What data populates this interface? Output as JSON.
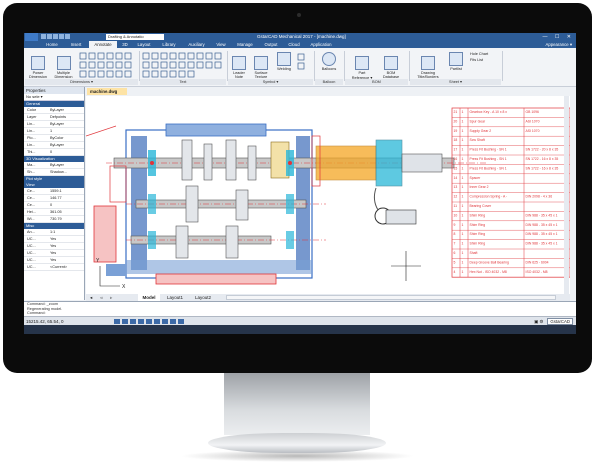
{
  "app": {
    "title": "GstarCAD Mechanical 2017 - [machine.dwg]",
    "workspace": "Drafting & Annotatio",
    "window_controls": "— ☐ ✕"
  },
  "tabs": [
    "Home",
    "Insert",
    "Annotate",
    "3D",
    "Layout",
    "Library",
    "Auxiliary",
    "View",
    "Manage",
    "Output",
    "Cloud",
    "Application"
  ],
  "active_tab": "Annotate",
  "ribbon_right": "Appearance ▾",
  "ribbon": {
    "power_dimension": "Power\nDimension",
    "multiple_dimension": "Multiple\nDimension",
    "leader_note": "Leader\nNote",
    "surface_texture": "Surface\nTexture",
    "welding": "Welding",
    "balloons": "Balloons",
    "part_reference": "Part\nReference ▾",
    "bom_database": "BOM\nDatabase",
    "drawing_title": "Drawing\nTitle/Borders",
    "partlist": "Partlist",
    "hole_chart": "Hole Chart",
    "fits_list": "Fits List",
    "groups": [
      "Dimensions ▾",
      "Text",
      "Symbol ▾",
      "Balloon",
      "BOM",
      "Sheet ▾"
    ]
  },
  "properties": {
    "header": "Properties",
    "selection": "No sele ▾",
    "sections": {
      "general": "General",
      "visualization": "3D Visualization",
      "plot": "Plot style",
      "view": "View",
      "misc": "Misc"
    },
    "general_rows": [
      {
        "k": "Color",
        "v": "ByLayer"
      },
      {
        "k": "Layer",
        "v": "Defpoints"
      },
      {
        "k": "Lin...",
        "v": "ByLayer"
      },
      {
        "k": "Lin...",
        "v": "1"
      },
      {
        "k": "Plo...",
        "v": "ByColor"
      },
      {
        "k": "Lin...",
        "v": "ByLayer"
      },
      {
        "k": "Thi...",
        "v": "0"
      }
    ],
    "visual_rows": [
      {
        "k": "Ma...",
        "v": "ByLayer"
      },
      {
        "k": "Sh...",
        "v": "Shadow..."
      }
    ],
    "view_rows": [
      {
        "k": "Ce...",
        "v": "1559.1"
      },
      {
        "k": "Ce...",
        "v": "146.77"
      },
      {
        "k": "Ce...",
        "v": "0"
      },
      {
        "k": "Hei...",
        "v": "361.05"
      },
      {
        "k": "Wi...",
        "v": "730.79"
      }
    ],
    "misc_rows": [
      {
        "k": "An...",
        "v": "1:1"
      },
      {
        "k": "UC...",
        "v": "Yes"
      },
      {
        "k": "UC...",
        "v": "Yes"
      },
      {
        "k": "UC...",
        "v": "Yes"
      },
      {
        "k": "UC...",
        "v": "Yes"
      },
      {
        "k": "UC...",
        "v": "<Current>"
      }
    ]
  },
  "document_tab": "machine.dwg",
  "bom": [
    [
      "21",
      "1",
      "Gearbox Key - A 10 x 8 x 20",
      "GB 1096"
    ],
    [
      "20",
      "1",
      "Spur Gear",
      "ASI 1070"
    ],
    [
      "19",
      "1",
      "Supply Gear 2",
      "ASI 1070"
    ],
    [
      "18",
      "1",
      "Scw Shaft",
      ""
    ],
    [
      "17",
      "1",
      "Press Fit Bushing - SN 176 - A - 30 x 40 x 40",
      "SN 1722 - 20 x 8 x 35"
    ],
    [
      "16",
      "1",
      "Press Fit Bushing - SN 176 - A - 30 x 40 x 40",
      "SN 1722 - 16 x 8 x 35"
    ],
    [
      "15",
      "1",
      "Press Fit Bushing - SN 176 - A - 30 x 40 x 40",
      "SN 1722 - 16 x 8 x 35"
    ],
    [
      "14",
      "1",
      "Spacer",
      ""
    ],
    [
      "13",
      "1",
      "Inner Gear 2",
      ""
    ],
    [
      "12",
      "1",
      "Compression Spring - A - 22 x 4 x 50",
      "DIN 2098 - 4 x 36"
    ],
    [
      "11",
      "1",
      "Bearing Cover",
      ""
    ],
    [
      "10",
      "1",
      "Shim Ring",
      "DIN 988 - 35 x 45 x 1"
    ],
    [
      "9",
      "1",
      "Shim Ring",
      "DIN 988 - 35 x 45 x 1"
    ],
    [
      "8",
      "1",
      "Shim Ring",
      "DIN 988 - 35 x 45 x 1"
    ],
    [
      "7",
      "1",
      "Shim Ring",
      "DIN 988 - 35 x 45 x 1"
    ],
    [
      "6",
      "1",
      "Shaft",
      ""
    ],
    [
      "5",
      "1",
      "Deep Groove Ball Bearing",
      "DIN 625 - 6004"
    ],
    [
      "4",
      "1",
      "Hex Nut - ISO 4032 - M8 x 1",
      "ISO 4032 - M8"
    ]
  ],
  "layout_tabs": [
    "Model",
    "Layout1",
    "Layout2"
  ],
  "command_lines": [
    "Command: _zoom",
    "Regenerating model.",
    "Command:"
  ],
  "status": {
    "coords": "15215.42, 65.54, 0",
    "brand": "GstarCAD"
  },
  "colors": {
    "ribbon_blue": "#2d5c97",
    "drawing_blue": "#3a6fc4",
    "drawing_red": "#e0353a",
    "drawing_cyan": "#29b7d8",
    "drawing_orange": "#f5a623",
    "highlight_yellow": "#fde3a5"
  }
}
